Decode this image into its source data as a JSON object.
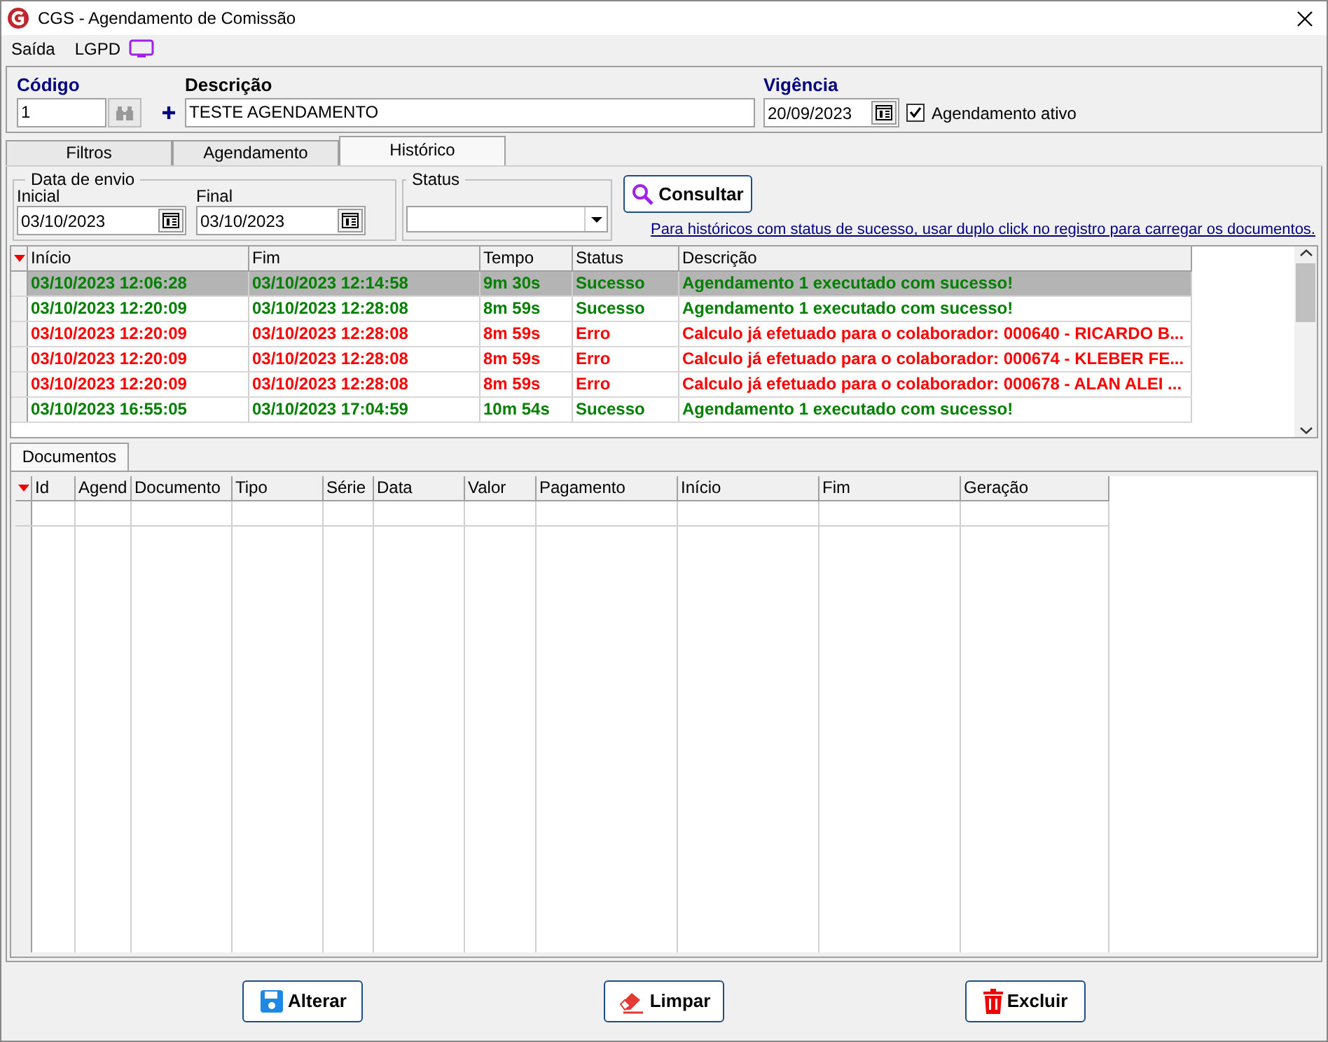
{
  "window": {
    "title": "CGS - Agendamento de Comissão"
  },
  "menu": [
    "Saída",
    "LGPD"
  ],
  "header": {
    "codigo": {
      "label": "Código",
      "value": "1"
    },
    "descricao": {
      "label": "Descrição",
      "value": "TESTE AGENDAMENTO"
    },
    "vigencia": {
      "label": "Vigência",
      "value": "20/09/2023"
    },
    "ativo": {
      "label": "Agendamento ativo",
      "checked": true
    }
  },
  "tabs": [
    {
      "label": "Filtros",
      "selected": false
    },
    {
      "label": "Agendamento",
      "selected": false
    },
    {
      "label": "Histórico",
      "selected": true
    }
  ],
  "filters": {
    "group_label": "Data de envio",
    "inicial": {
      "label": "Inicial",
      "value": "03/10/2023"
    },
    "final": {
      "label": "Final",
      "value": "03/10/2023"
    },
    "status": {
      "label": "Status"
    },
    "search_button": "Consultar",
    "hint_link": "Para históricos com status de sucesso, usar duplo click no registro para carregar os documentos."
  },
  "history": {
    "columns": [
      "Início",
      "Fim",
      "Tempo",
      "Status",
      "Descrição"
    ],
    "rows": [
      {
        "cells": [
          "03/10/2023 12:06:28",
          "03/10/2023 12:14:58",
          "9m 30s",
          "Sucesso",
          "Agendamento 1 executado com sucesso!"
        ],
        "color": "#008000",
        "selected": true
      },
      {
        "cells": [
          "03/10/2023 12:20:09",
          "03/10/2023 12:28:08",
          "8m 59s",
          "Sucesso",
          "Agendamento 1 executado com sucesso!"
        ],
        "color": "#008000",
        "selected": false
      },
      {
        "cells": [
          "03/10/2023 12:20:09",
          "03/10/2023 12:28:08",
          "8m 59s",
          "Erro",
          "Calculo já efetuado para o colaborador: 000640 - RICARDO B..."
        ],
        "color": "#ff0000",
        "selected": false
      },
      {
        "cells": [
          "03/10/2023 12:20:09",
          "03/10/2023 12:28:08",
          "8m 59s",
          "Erro",
          "Calculo já efetuado para o colaborador: 000674 - KLEBER FE..."
        ],
        "color": "#ff0000",
        "selected": false
      },
      {
        "cells": [
          "03/10/2023 12:20:09",
          "03/10/2023 12:28:08",
          "8m 59s",
          "Erro",
          "Calculo já efetuado para o colaborador: 000678 - ALAN ALEI ..."
        ],
        "color": "#ff0000",
        "selected": false
      },
      {
        "cells": [
          "03/10/2023 16:55:05",
          "03/10/2023 17:04:59",
          "10m 54s",
          "Sucesso",
          "Agendamento 1 executado com sucesso!"
        ],
        "color": "#008000",
        "selected": false
      }
    ]
  },
  "documents_tab": {
    "label": "Documentos",
    "selected": true
  },
  "documents": {
    "columns": [
      "Id",
      "Agend",
      "Documento",
      "Tipo",
      "Série",
      "Data",
      "Valor",
      "Pagamento",
      "Início",
      "Fim",
      "Geração"
    ]
  },
  "buttons": [
    {
      "label": "Alterar",
      "kind": "save"
    },
    {
      "label": "Limpar",
      "kind": "clear"
    },
    {
      "label": "Excluir",
      "kind": "delete"
    }
  ]
}
